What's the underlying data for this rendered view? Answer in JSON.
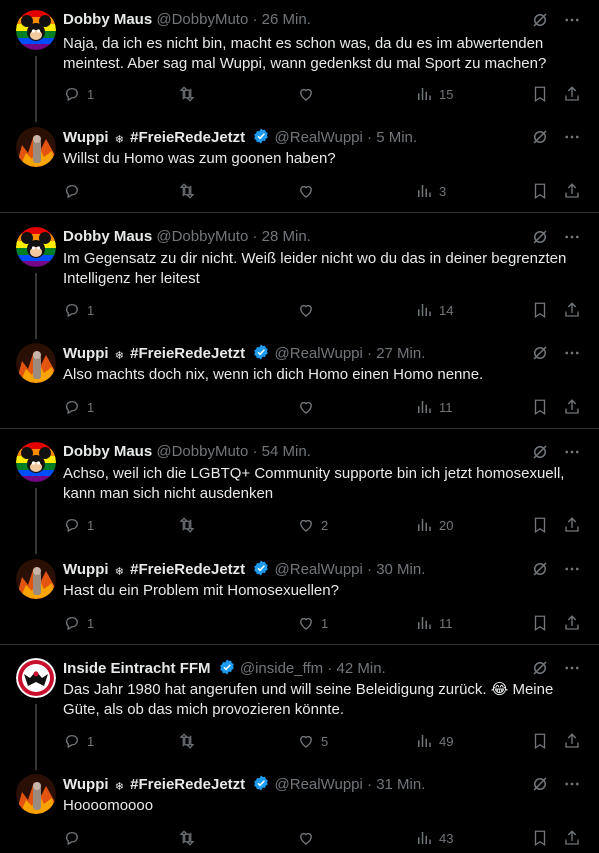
{
  "tweets": [
    {
      "name": "Dobby Maus",
      "handle": "@DobbyMuto",
      "time": "26 Min.",
      "text": "Naja, da ich es nicht bin, macht es schon was, da du es im abwertenden meintest. Aber sag mal Wuppi, wann gedenkst du mal Sport zu machen?",
      "replies": "1",
      "retweets": "",
      "likes": "",
      "views": "15"
    },
    {
      "name": "Wuppi",
      "name_suffix": "#FreieRedeJetzt",
      "handle": "@RealWuppi",
      "time": "5 Min.",
      "text": "Willst du Homo was zum goonen haben?",
      "replies": "",
      "retweets": "",
      "likes": "",
      "views": "3"
    },
    {
      "name": "Dobby Maus",
      "handle": "@DobbyMuto",
      "time": "28 Min.",
      "text": "Im Gegensatz zu dir nicht. Weiß leider nicht wo du das in deiner begrenzten Intelligenz her leitest",
      "replies": "1",
      "retweets": "",
      "likes": "",
      "views": "14"
    },
    {
      "name": "Wuppi",
      "name_suffix": "#FreieRedeJetzt",
      "handle": "@RealWuppi",
      "time": "27 Min.",
      "text": "Also machts doch nix, wenn ich dich Homo einen Homo nenne.",
      "replies": "1",
      "retweets": "",
      "likes": "",
      "views": "11"
    },
    {
      "name": "Dobby Maus",
      "handle": "@DobbyMuto",
      "time": "54 Min.",
      "text": "Achso, weil ich die LGBTQ+ Community supporte bin ich jetzt homosexuell, kann man sich nicht ausdenken",
      "replies": "1",
      "retweets": "",
      "likes": "2",
      "views": "20"
    },
    {
      "name": "Wuppi",
      "name_suffix": "#FreieRedeJetzt",
      "handle": "@RealWuppi",
      "time": "30 Min.",
      "text": "Hast du ein Problem mit Homosexuellen?",
      "replies": "1",
      "retweets": "",
      "likes": "1",
      "views": "11"
    },
    {
      "name": "Inside Eintracht FFM",
      "handle": "@inside_ffm",
      "time": "42 Min.",
      "text": "Das Jahr 1980 hat angerufen und will seine Beleidigung zurück. 😂 Meine Güte, als ob das mich provozieren könnte.",
      "replies": "1",
      "retweets": "",
      "likes": "5",
      "views": "49"
    },
    {
      "name": "Wuppi",
      "name_suffix": "#FreieRedeJetzt",
      "handle": "@RealWuppi",
      "time": "31 Min.",
      "text": "Hoooomoooo",
      "replies": "",
      "retweets": "",
      "likes": "",
      "views": "43"
    }
  ],
  "separator": "·",
  "gear_glyph": "❄",
  "colors": {
    "verified": "#1d9bf0",
    "muted": "#71767b",
    "text": "#e7e9ea",
    "divider": "#2f3336"
  }
}
